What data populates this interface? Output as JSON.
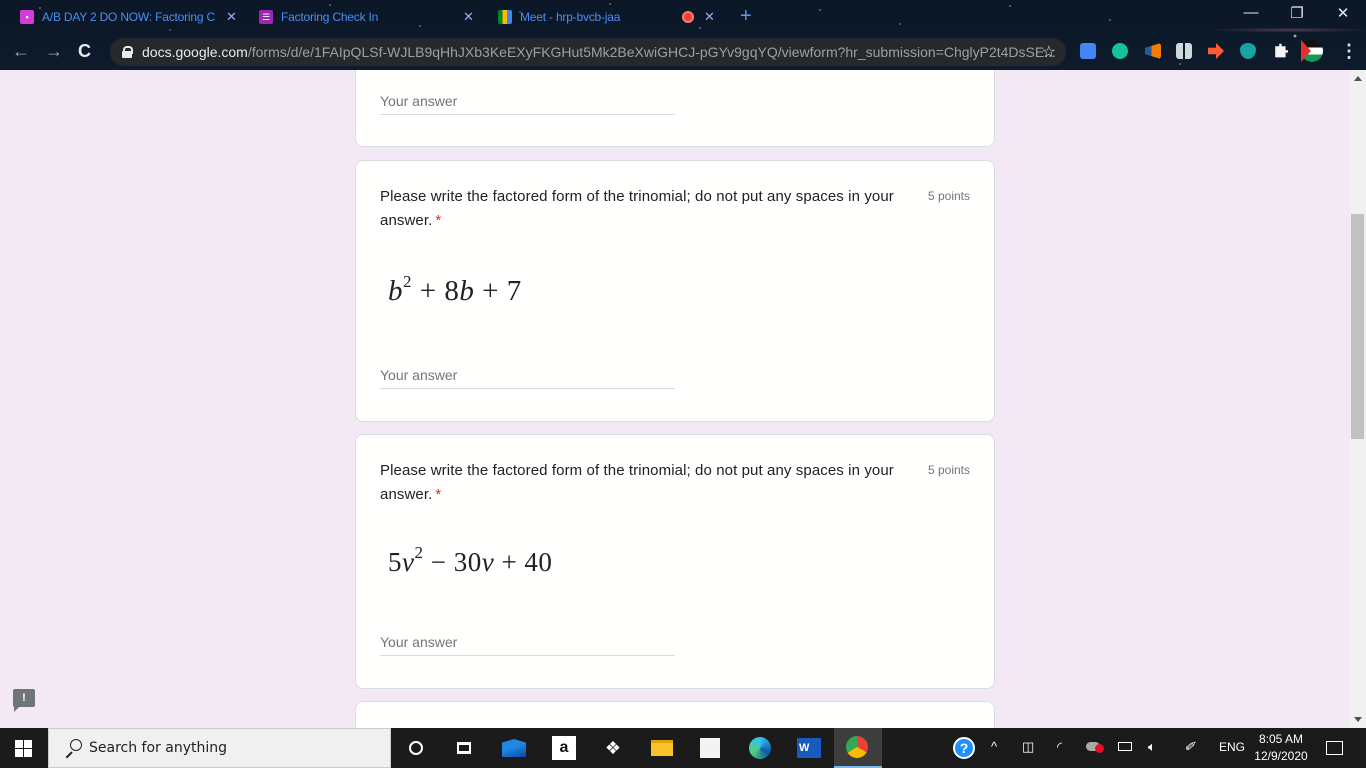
{
  "browser": {
    "tabs": [
      {
        "title": "A/B DAY 2 DO NOW: Factoring C",
        "icon": "classroom-icon",
        "color": "#d53bd6"
      },
      {
        "title": "Factoring Check In",
        "icon": "forms-icon",
        "color": "#9c27b0"
      },
      {
        "title": "Meet - hrp-bvcb-jaa",
        "icon": "meet-icon",
        "recording": true
      }
    ],
    "close_glyph": "✕",
    "new_tab_glyph": "+",
    "window_controls": {
      "minimize": "—",
      "restore": "❐",
      "close": "✕"
    },
    "nav": {
      "back": "←",
      "forward": "→",
      "reload": "C"
    },
    "url_host": "docs.google.com",
    "url_path": "/forms/d/e/1FAIpQLSf-WJLB9qHhJXb3KeEXyFKGHut5Mk2BeXwiGHCJ-pGYv9gqYQ/viewform?hr_submission=ChglyP2t4DsSE...",
    "bookmark_glyph": "☆",
    "extensions": [
      "google-translate-icon",
      "grammarly-icon",
      "announcer-icon",
      "split-screen-icon",
      "arrow-extension-icon",
      "alien-extension-icon",
      "puzzle-extensions-icon",
      "profile-avatar-icon"
    ],
    "menu_glyph": "⋮"
  },
  "form": {
    "placeholder": "Your answer",
    "questions": [
      {
        "title": "Please write the factored form of the trinomial; do not put any spaces in your answer.",
        "required_mark": "*",
        "points": "5 points",
        "expression": {
          "coef": "",
          "var": "b",
          "exp": "2",
          "rest": " + 8",
          "var2": "b",
          "tail": " + 7"
        }
      },
      {
        "title": "Please write the factored form of the trinomial; do not put any spaces in your answer.",
        "required_mark": "*",
        "points": "5 points",
        "expression": {
          "coef": "5",
          "var": "v",
          "exp": "2",
          "rest": " − 30",
          "var2": "v",
          "tail": " + 40"
        }
      }
    ],
    "feedback_glyph": "!"
  },
  "taskbar": {
    "search_placeholder": "Search for anything",
    "apps": [
      "cortana-icon",
      "task-view-icon",
      "mail-icon",
      "amazon-icon",
      "dropbox-icon",
      "file-explorer-icon",
      "store-icon",
      "edge-icon",
      "word-icon",
      "chrome-icon"
    ],
    "tray": {
      "help": "?",
      "chevron": "^",
      "language": "ENG",
      "time": "8:05 AM",
      "date": "12/9/2020"
    }
  }
}
